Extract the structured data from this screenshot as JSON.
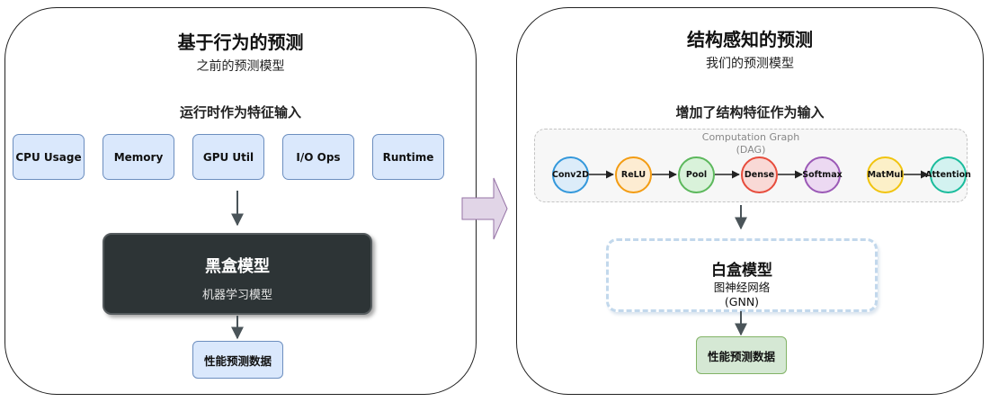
{
  "left_panel": {
    "title": "基于行为的预测",
    "subtitle": "之前的预测模型",
    "section_title": "运行时作为特征输入",
    "features": [
      {
        "label": "CPU Usage"
      },
      {
        "label": "Memory"
      },
      {
        "label": "GPU Util"
      },
      {
        "label": "I/O Ops"
      },
      {
        "label": "Runtime"
      }
    ],
    "model": {
      "title": "黑盒模型",
      "subtitle": "机器学习模型"
    },
    "output": "性能预测数据"
  },
  "right_panel": {
    "title": "结构感知的预测",
    "subtitle": "我们的预测模型",
    "section_title": "增加了结构特征作为输入",
    "graph": {
      "label_line1": "Computation Graph",
      "label_line2": "(DAG)",
      "nodes": [
        {
          "label": "Conv2D",
          "fill": "#dcecf9",
          "stroke": "#3498db"
        },
        {
          "label": "ReLU",
          "fill": "#fdecd2",
          "stroke": "#f39c12"
        },
        {
          "label": "Pool",
          "fill": "#d9f2da",
          "stroke": "#5cb85c"
        },
        {
          "label": "Dense",
          "fill": "#f9d9d6",
          "stroke": "#e74c3c"
        },
        {
          "label": "Softmax",
          "fill": "#ecd9f2",
          "stroke": "#9b59b6"
        },
        {
          "label": "MatMul",
          "fill": "#fcf0c8",
          "stroke": "#f1c40f"
        },
        {
          "label": "Attention",
          "fill": "#d3f2f0",
          "stroke": "#1abc9c"
        }
      ]
    },
    "model": {
      "title": "白盒模型",
      "subtitle_line1": "图神经网络",
      "subtitle_line2": "(GNN)"
    },
    "output": "性能预测数据"
  },
  "colors": {
    "arrow": "#4a5459",
    "transition_arrow_fill": "#e1d5e7",
    "transition_arrow_stroke": "#9673a6"
  }
}
